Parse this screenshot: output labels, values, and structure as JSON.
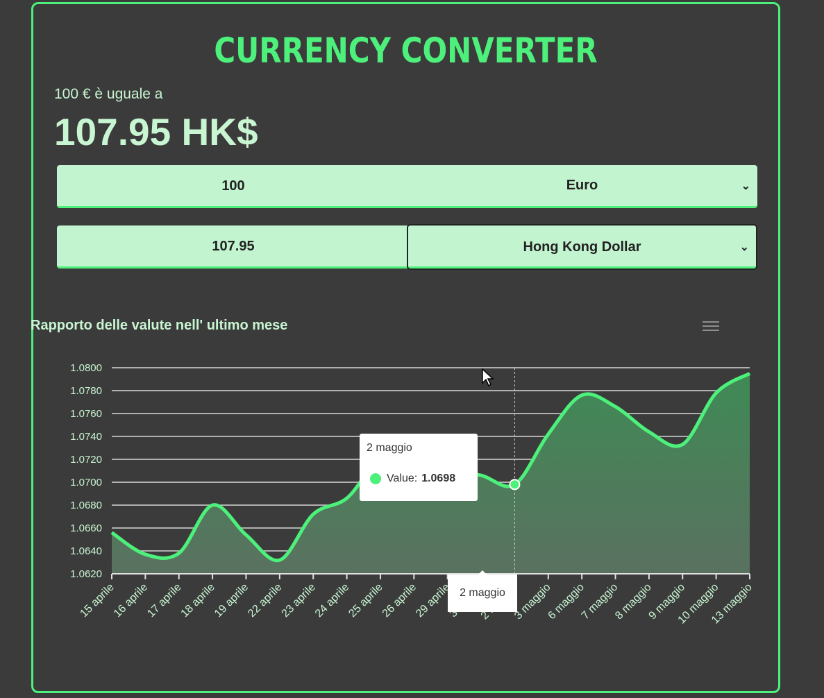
{
  "app": {
    "title": "CURRENCY CONVERTER",
    "subtitle": "100 € è uguale a",
    "result": "107.95 HK$"
  },
  "from": {
    "amount": "100",
    "currency": "Euro"
  },
  "to": {
    "amount": "107.95",
    "currency": "Hong Kong Dollar"
  },
  "colors": {
    "accent": "#4cf07a",
    "field_bg": "#c3f4d0",
    "background": "#3b3b3b"
  },
  "icons": {
    "menu": "hamburger-menu-icon",
    "chevron": "chevron-down-icon"
  },
  "chart_data": {
    "type": "area",
    "title": "Rapporto delle valute nell' ultimo mese",
    "categories": [
      "15 aprile",
      "16 aprile",
      "17 aprile",
      "18 aprile",
      "19 aprile",
      "22 aprile",
      "23 aprile",
      "24 aprile",
      "25 aprile",
      "26 aprile",
      "29 aprile",
      "30 aprile",
      "2 maggio",
      "3 maggio",
      "6 maggio",
      "7 maggio",
      "8 maggio",
      "9 maggio",
      "10 maggio",
      "13 maggio"
    ],
    "series": [
      {
        "values": [
          1.0656,
          1.0637,
          1.0638,
          1.068,
          1.0654,
          1.0632,
          1.0672,
          1.0686,
          1.072,
          1.0716,
          1.071,
          1.0706,
          1.0698,
          1.0742,
          1.0776,
          1.0766,
          1.0744,
          1.0733,
          1.0778,
          1.0795
        ]
      }
    ],
    "ylim": [
      1.062,
      1.08
    ],
    "yticks": [
      "1.0800",
      "1.0780",
      "1.0760",
      "1.0740",
      "1.0720",
      "1.0700",
      "1.0680",
      "1.0660",
      "1.0640",
      "1.0620"
    ],
    "grid": true,
    "tooltip": {
      "date": "2 maggio",
      "label": "Value:",
      "value": "1.0698"
    },
    "crosshair_label": "2 maggio"
  }
}
